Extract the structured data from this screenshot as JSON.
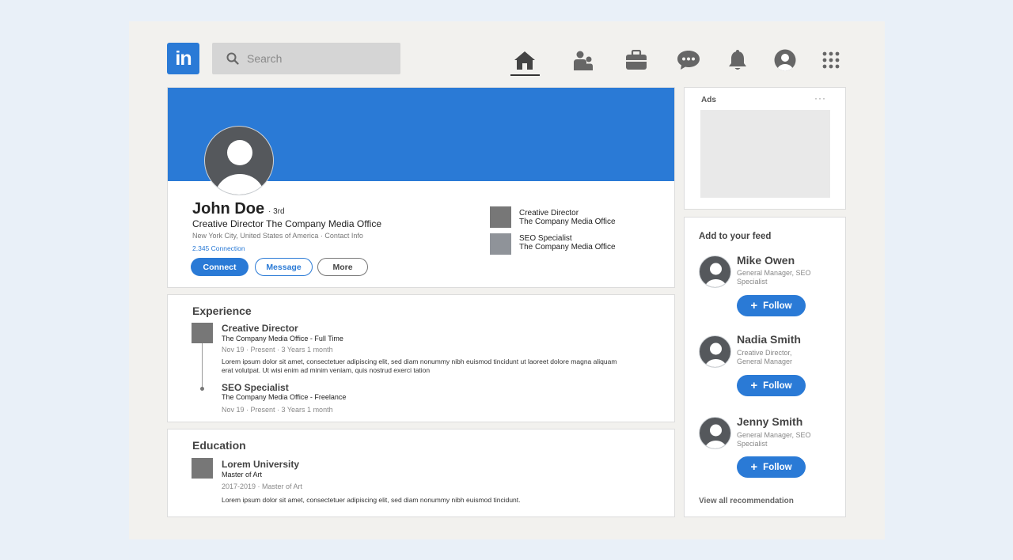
{
  "brand": {
    "logo_text": "in",
    "accent": "#2a7ad6"
  },
  "search": {
    "placeholder": "Search"
  },
  "nav": {
    "items": [
      {
        "name": "home",
        "icon": "home-icon",
        "active": true
      },
      {
        "name": "network",
        "icon": "people-icon",
        "active": false
      },
      {
        "name": "jobs",
        "icon": "briefcase-icon",
        "active": false
      },
      {
        "name": "messaging",
        "icon": "chat-icon",
        "active": false
      },
      {
        "name": "notifications",
        "icon": "bell-icon",
        "active": false
      },
      {
        "name": "me",
        "icon": "user-avatar-icon",
        "active": false
      },
      {
        "name": "apps",
        "icon": "grid-icon",
        "active": false
      }
    ]
  },
  "profile": {
    "name": "John Doe",
    "degree": "· 3rd",
    "headline": "Creative Director The Company Media Office",
    "location": "New York City, United States of America · Contact Info",
    "connections": "2.345 Connection",
    "buttons": {
      "connect": "Connect",
      "message": "Message",
      "more": "More"
    },
    "positions": [
      {
        "title": "Creative Director",
        "company": "The Company Media Office"
      },
      {
        "title": "SEO Specialist",
        "company": "The Company Media Office"
      }
    ]
  },
  "experience": {
    "title": "Experience",
    "items": [
      {
        "title": "Creative Director",
        "company": "The Company Media Office - Full Time",
        "dates": "Nov 19 · Present · 3 Years 1 month",
        "description": "Lorem ipsum dolor sit amet, consectetuer adipiscing elit, sed diam nonummy nibh euismod tincidunt ut laoreet dolore magna aliquam erat volutpat. Ut wisi enim ad minim veniam, quis nostrud exerci tation"
      },
      {
        "title": "SEO Specialist",
        "company": "The Company Media Office - Freelance",
        "dates": "Nov 19 · Present · 3 Years 1 month"
      }
    ]
  },
  "education": {
    "title": "Education",
    "items": [
      {
        "school": "Lorem University",
        "degree": "Master of Art",
        "dates": "2017-2019 · Master of Art",
        "description": "Lorem ipsum dolor sit amet, consectetuer adipiscing elit, sed diam nonummy nibh euismod tincidunt."
      }
    ]
  },
  "ads": {
    "label": "Ads",
    "menu": "···"
  },
  "feed": {
    "title": "Add to your feed",
    "people": [
      {
        "name": "Mike Owen",
        "title": "General Manager, SEO Specialist",
        "follow": "Follow"
      },
      {
        "name": "Nadia Smith",
        "title": "Creative Director, General Manager",
        "follow": "Follow"
      },
      {
        "name": "Jenny Smith",
        "title": "General Manager, SEO Specialist",
        "follow": "Follow"
      }
    ],
    "view_all": "View all recommendation"
  }
}
